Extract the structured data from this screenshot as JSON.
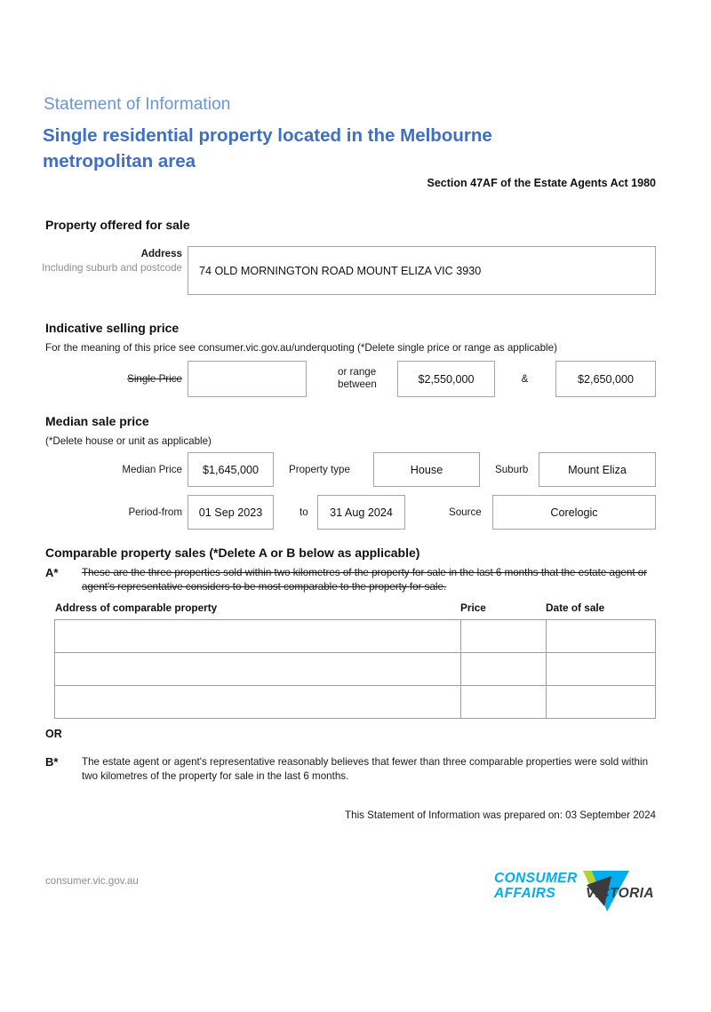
{
  "header": {
    "subtitle": "Statement of Information",
    "title": "Single residential property located in the Melbourne metropolitan area",
    "section_reference": "Section 47AF of the Estate Agents Act 1980"
  },
  "property_offered": {
    "section_title": "Property offered for sale",
    "address_label": "Address",
    "address_sublabel": "Including suburb and postcode",
    "address_value": "74 OLD MORNINGTON ROAD MOUNT ELIZA VIC 3930"
  },
  "indicative_price": {
    "section_title": "Indicative selling price",
    "note": "For the meaning of this price see consumer.vic.gov.au/underquoting (*Delete single price or range as applicable)",
    "single_price_label": "Single Price",
    "single_price_value": "",
    "or_range_label_line1": "or range",
    "or_range_label_line2": "between",
    "range_low": "$2,550,000",
    "ampersand": "&",
    "range_high": "$2,650,000"
  },
  "median_price": {
    "section_title": "Median sale price",
    "note": "(*Delete house or unit as applicable)",
    "median_price_label": "Median Price",
    "median_price_value": "$1,645,000",
    "property_type_label": "Property type",
    "property_type_value": "House",
    "suburb_label": "Suburb",
    "suburb_value": "Mount Eliza",
    "period_from_label": "Period-from",
    "period_from_value": "01 Sep 2023",
    "to_label": "to",
    "period_to_value": "31 Aug 2024",
    "source_label": "Source",
    "source_value": "Corelogic"
  },
  "comparable_sales": {
    "section_title": "Comparable property sales (*Delete A or B below as applicable)",
    "option_a_marker": "A*",
    "option_a_text": "These are the three properties sold within two kilometres of the property for sale in the last 6 months that the estate agent or agent's representative considers to be most comparable to the property for sale.",
    "columns": [
      "Address of comparable property",
      "Price",
      "Date of sale"
    ],
    "rows": [
      {
        "address": "",
        "price": "",
        "date": ""
      },
      {
        "address": "",
        "price": "",
        "date": ""
      },
      {
        "address": "",
        "price": "",
        "date": ""
      }
    ],
    "or_label": "OR",
    "option_b_marker": "B*",
    "option_b_text": "The estate agent or agent's representative reasonably believes that fewer than three comparable properties were sold within two kilometres of the property for sale in the last 6 months."
  },
  "footer": {
    "prepared_text": "This Statement of Information was prepared on: 03 September 2024",
    "url": "consumer.vic.gov.au",
    "logo_line1": "CONSUMER",
    "logo_line2": "AFFAIRS",
    "logo_word_victoria": "VICTORIA"
  },
  "colors": {
    "heading_blue": "#3f6fc4",
    "subheading_blue": "#6a95d8",
    "logo_cyan": "#00aeef",
    "logo_lime": "#b5d334",
    "logo_dark": "#3b3b3b",
    "box_border": "#a6a6a6"
  }
}
